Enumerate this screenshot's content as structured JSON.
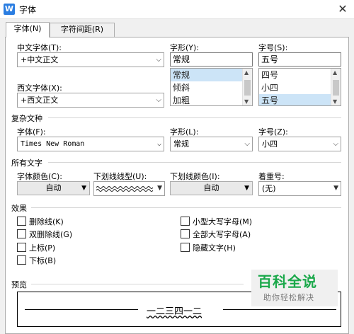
{
  "window": {
    "icon_letter": "W",
    "title": "字体",
    "close": "✕"
  },
  "tabs": [
    {
      "label": "字体(N)",
      "active": true
    },
    {
      "label": "字符间距(R)",
      "active": false
    }
  ],
  "chinese_font": {
    "label": "中文字体(T):",
    "value": "+中文正文"
  },
  "style": {
    "label": "字形(Y):",
    "value": "常规",
    "options": [
      "常规",
      "倾斜",
      "加粗"
    ],
    "selected": "常规"
  },
  "size": {
    "label": "字号(S):",
    "value": "五号",
    "options": [
      "四号",
      "小四",
      "五号"
    ],
    "selected": "五号"
  },
  "western_font": {
    "label": "西文字体(X):",
    "value": "+西文正文"
  },
  "complex": {
    "section": "复杂文种",
    "font_label": "字体(F):",
    "font_value": "Times New Roman",
    "style_label": "字形(L):",
    "style_value": "常规",
    "size_label": "字号(Z):",
    "size_value": "小四"
  },
  "all_text": {
    "section": "所有文字",
    "font_color_label": "字体颜色(C):",
    "font_color_value": "自动",
    "underline_label": "下划线线型(U):",
    "underline_color_label": "下划线颜色(I):",
    "underline_color_value": "自动",
    "emphasis_label": "着重号:",
    "emphasis_value": "(无)"
  },
  "effects": {
    "section": "效果",
    "left": [
      "删除线(K)",
      "双删除线(G)",
      "上标(P)",
      "下标(B)"
    ],
    "right": [
      "小型大写字母(M)",
      "全部大写字母(A)",
      "隐藏文字(H)"
    ]
  },
  "preview": {
    "section": "预览",
    "sample": "一二三四一二"
  },
  "watermark": {
    "title": "百科全说",
    "subtitle": "助你轻松解决"
  },
  "colors": {
    "accent": "#2a7de1",
    "selection": "#cce4f7",
    "watermark_green": "#1aa84a"
  }
}
